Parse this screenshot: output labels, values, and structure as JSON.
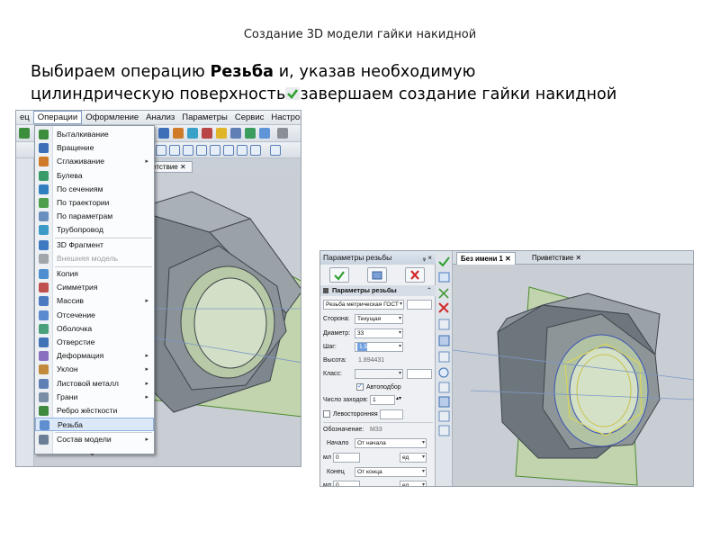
{
  "slide": {
    "title": "Создание 3D модели гайки накидной",
    "line1_pre": "Выбираем операцию ",
    "line1_bold": "Резьба",
    "line1_post": " и, указав   необходимую",
    "line2_pre": "цилиндрическую  поверхность",
    "line2_post": "завершаем создание гайки накидной"
  },
  "shot1": {
    "menubar": {
      "items": [
        "ец",
        "Операции",
        "Оформление",
        "Анализ",
        "Параметры",
        "Сервис",
        "Настройка"
      ],
      "active": "Операции"
    },
    "doc_tab": "ветствие ✕",
    "menu": {
      "items": [
        {
          "label": "Выталкивание",
          "icon": "extrude-icon"
        },
        {
          "label": "Вращение",
          "icon": "rotate-icon"
        },
        {
          "label": "Сглаживание",
          "icon": "smooth-icon",
          "submenu": true
        },
        {
          "label": "Булева",
          "icon": "boolean-icon"
        },
        {
          "label": "По сечениям",
          "icon": "loft-icon"
        },
        {
          "label": "По траектории",
          "icon": "sweep-icon"
        },
        {
          "label": "По параметрам",
          "icon": "params-icon"
        },
        {
          "label": "Трубопровод",
          "icon": "pipe-icon"
        },
        {
          "label": "3D Фрагмент",
          "icon": "fragment-icon"
        },
        {
          "label": "Внешняя модель",
          "icon": "external-model-icon",
          "disabled": true
        },
        {
          "label": "Копия",
          "icon": "copy-icon"
        },
        {
          "label": "Симметрия",
          "icon": "symmetry-icon"
        },
        {
          "label": "Массив",
          "icon": "array-icon",
          "submenu": true
        },
        {
          "label": "Отсечение",
          "icon": "cut-icon"
        },
        {
          "label": "Оболочка",
          "icon": "shell-icon"
        },
        {
          "label": "Отверстие",
          "icon": "hole-icon"
        },
        {
          "label": "Деформация",
          "icon": "deform-icon",
          "submenu": true
        },
        {
          "label": "Уклон",
          "icon": "draft-icon",
          "submenu": true
        },
        {
          "label": "Листовой металл",
          "icon": "sheet-metal-icon",
          "submenu": true
        },
        {
          "label": "Грани",
          "icon": "faces-icon",
          "submenu": true
        },
        {
          "label": "Ребро жёсткости",
          "icon": "rib-icon"
        },
        {
          "label": "Резьба",
          "icon": "thread-icon",
          "highlighted": true
        },
        {
          "label": "Состав модели",
          "icon": "composition-icon",
          "submenu": true
        }
      ],
      "more": "⌄"
    }
  },
  "shot2": {
    "panel_title": "Параметры резьбы",
    "pin": "ᵩ ×",
    "section_title": "Параметры резьбы",
    "thread_type": "Резьба метрическая ГОСТ",
    "fields": {
      "side_label": "Сторона:",
      "side_value": "Текущая",
      "diameter_label": "Диаметр:",
      "diameter_value": "33",
      "pitch_label": "Шаг:",
      "pitch_value": "1.5",
      "height_label": "Высота:",
      "height_value": "1.894431",
      "class_label": "Класс:",
      "autoselect_label": "Автоподбор",
      "starts_label": "Число заходов:",
      "starts_value": "1",
      "lefthand_label": "Левосторонняя",
      "designation_label": "Обозначение:",
      "designation_value": "М33",
      "start_label": "Начало",
      "start_value": "От начала",
      "start_num": "0",
      "start_unit": "ед",
      "end_label": "Конец",
      "end_value": "От конца",
      "end_num": "0",
      "end_unit": "ед",
      "prefix_a": "мл",
      "prefix_b": "мл"
    },
    "tabs": [
      {
        "label": "Без имени 1 ✕",
        "active": true
      },
      {
        "label": "Приветствие ✕",
        "active": false
      }
    ]
  },
  "colors": {
    "model_face": "#8a9198",
    "model_dark": "#5d646b",
    "plane": "#b9d39a",
    "plane_edge": "#4f8a2f",
    "menu_highlight": "#dbe8f8"
  }
}
